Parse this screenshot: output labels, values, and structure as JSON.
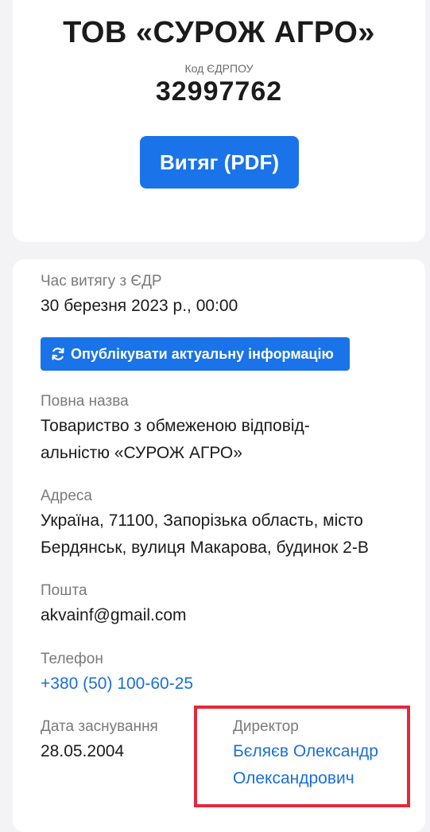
{
  "header": {
    "company_title": "ТОВ «СУРОЖ АГРО»",
    "code_label": "Код ЄДРПОУ",
    "code_value": "32997762",
    "pdf_button_label": "Витяг (PDF)"
  },
  "info": {
    "extract_time_label": "Час витягу з ЄДР",
    "extract_time_value": "30 березня 2023 р., 00:00",
    "publish_button_label": "Опублікувати актуальну інформацію",
    "full_name_label": "Повна назва",
    "full_name_line1": "Товариство з обмеженою відповід-",
    "full_name_line2": "альністю «СУРОЖ АГРО»",
    "address_label": "Адреса",
    "address_line1": "Україна, 71100, Запорізька область, місто",
    "address_line2": "Бердянськ, вулиця Макарова, будинок 2-В",
    "email_label": "Пошта",
    "email_value": "akvainf@gmail.com",
    "phone_label": "Телефон",
    "phone_value": "+380 (50) 100-60-25",
    "founded_label": "Дата заснування",
    "founded_value": "28.05.2004",
    "director_label": "Директор",
    "director_line1": "Бєляєв Олександр",
    "director_line2": "Олександрович"
  },
  "colors": {
    "accent": "#1a73e8",
    "link": "#1a6fd6",
    "highlight": "#e4283c"
  }
}
